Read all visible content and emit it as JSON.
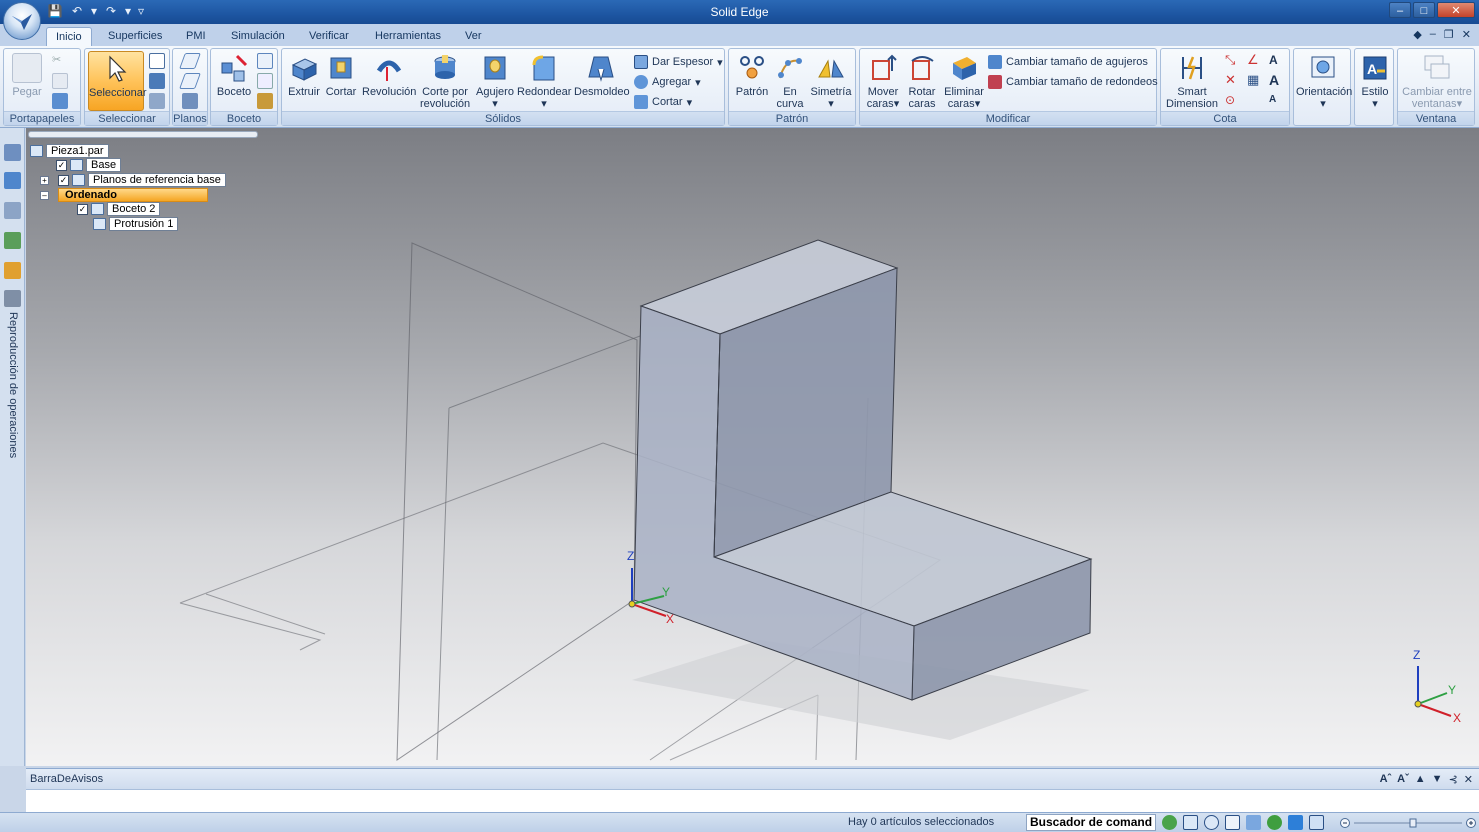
{
  "window": {
    "title": "Solid Edge"
  },
  "tabs": [
    {
      "label": "Inicio",
      "active": true
    },
    {
      "label": "Superficies"
    },
    {
      "label": "PMI"
    },
    {
      "label": "Simulación"
    },
    {
      "label": "Verificar"
    },
    {
      "label": "Herramientas"
    },
    {
      "label": "Ver"
    }
  ],
  "groups": {
    "portapapeles": {
      "label": "Portapapeles",
      "pegar": "Pegar"
    },
    "seleccionar": {
      "label": "Seleccionar",
      "seleccionar": "Seleccionar"
    },
    "planos": {
      "label": "Planos"
    },
    "boceto": {
      "label": "Boceto",
      "boceto": "Boceto"
    },
    "solidos": {
      "label": "Sólidos",
      "extruir": "Extruir",
      "cortar": "Cortar",
      "revolucion": "Revolución",
      "corte_revolucion_1": "Corte por",
      "corte_revolucion_2": "revolución",
      "agujero": "Agujero",
      "redondear": "Redondear",
      "desmoldeo": "Desmoldeo",
      "dar_espesor": "Dar Espesor",
      "agregar": "Agregar",
      "cortar_small": "Cortar"
    },
    "patron": {
      "label": "Patrón",
      "patron": "Patrón",
      "en_curva_1": "En",
      "en_curva_2": "curva",
      "simetria": "Simetría"
    },
    "modificar": {
      "label": "Modificar",
      "mover_1": "Mover",
      "mover_2": "caras",
      "rotar_1": "Rotar",
      "rotar_2": "caras",
      "eliminar_1": "Eliminar",
      "eliminar_2": "caras",
      "cambiar_agujeros": "Cambiar tamaño de agujeros",
      "cambiar_redondeos": "Cambiar tamaño de redondeos"
    },
    "cota": {
      "label": "Cota",
      "smart_1": "Smart",
      "smart_2": "Dimension"
    },
    "orientacion": {
      "orientacion": "Orientación"
    },
    "estilo": {
      "estilo": "Estilo"
    },
    "ventana": {
      "label": "Ventana",
      "cambiar_1": "Cambiar entre",
      "cambiar_2": "ventanas"
    }
  },
  "left_panel": {
    "vertical_label": "Reproducción de operaciones"
  },
  "tree": {
    "root": "Pieza1.par",
    "base": "Base",
    "planos": "Planos de referencia base",
    "ordenado": "Ordenado",
    "boceto": "Boceto 2",
    "protrusion": "Protrusión 1"
  },
  "axes": {
    "x": "X",
    "y": "Y",
    "z": "Z"
  },
  "notice_bar": {
    "title": "BarraDeAvisos"
  },
  "status": {
    "message": "Hay 0 artículos seleccionados",
    "command_finder": "Buscador de comand"
  },
  "colors": {
    "select_highlight": "#f7a524",
    "ribbon_blue": "#1d56a2",
    "part_face": "#a3adc3",
    "axis_x": "#d0202a",
    "axis_y": "#2ea043",
    "axis_z": "#1f3fbf"
  }
}
